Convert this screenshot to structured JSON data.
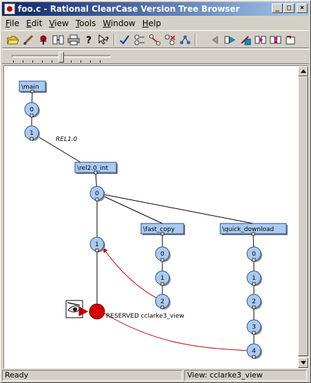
{
  "window": {
    "title": "foo.c - Rational ClearCase Version Tree Browser"
  },
  "title_buttons": {
    "minimize": "_",
    "maximize": "□",
    "close": "×"
  },
  "menu": [
    "File",
    "Edit",
    "View",
    "Tools",
    "Window",
    "Help"
  ],
  "toolbar": {
    "icons": [
      "open-folder-icon",
      "brush-icon",
      "pin-icon",
      "compare-icon",
      "print-icon",
      "help-icon",
      "context-help-icon",
      "checkmark-icon",
      "labels-icon",
      "merge-arrows-icon",
      "branch-x-icon",
      "tree-icon",
      "back-icon",
      "forward-icon",
      "checkout-icon",
      "checkin-icon",
      "undo-icon",
      "clear-icon"
    ]
  },
  "zoom": {
    "level": 0.5
  },
  "tree": {
    "branches": [
      {
        "id": "main",
        "label": "\\main"
      },
      {
        "id": "rel2",
        "label": "\\rel2.0_int"
      },
      {
        "id": "fast",
        "label": "\\fast_copy"
      },
      {
        "id": "quick",
        "label": "\\quick_download"
      }
    ],
    "versions": [
      {
        "id": "m0",
        "label": "0"
      },
      {
        "id": "m1",
        "label": "1"
      },
      {
        "id": "r0",
        "label": "0"
      },
      {
        "id": "r1",
        "label": "1"
      },
      {
        "id": "f0",
        "label": "0"
      },
      {
        "id": "f1",
        "label": "1"
      },
      {
        "id": "f2",
        "label": "2"
      },
      {
        "id": "q0",
        "label": "0"
      },
      {
        "id": "q1",
        "label": "1"
      },
      {
        "id": "q2",
        "label": "2"
      },
      {
        "id": "q3",
        "label": "3"
      },
      {
        "id": "q4",
        "label": "4"
      }
    ],
    "version_label": "REL1.0",
    "checkout": {
      "label": "RESERVED cclarke3_view"
    },
    "colors": {
      "node_fill": "#aacbf0",
      "node_stroke": "#2a4f8a",
      "merge_arrow": "#c00000",
      "checkout_fill": "#d40000"
    }
  },
  "status": {
    "left": "Ready",
    "view": "View:  cclarke3_view"
  }
}
